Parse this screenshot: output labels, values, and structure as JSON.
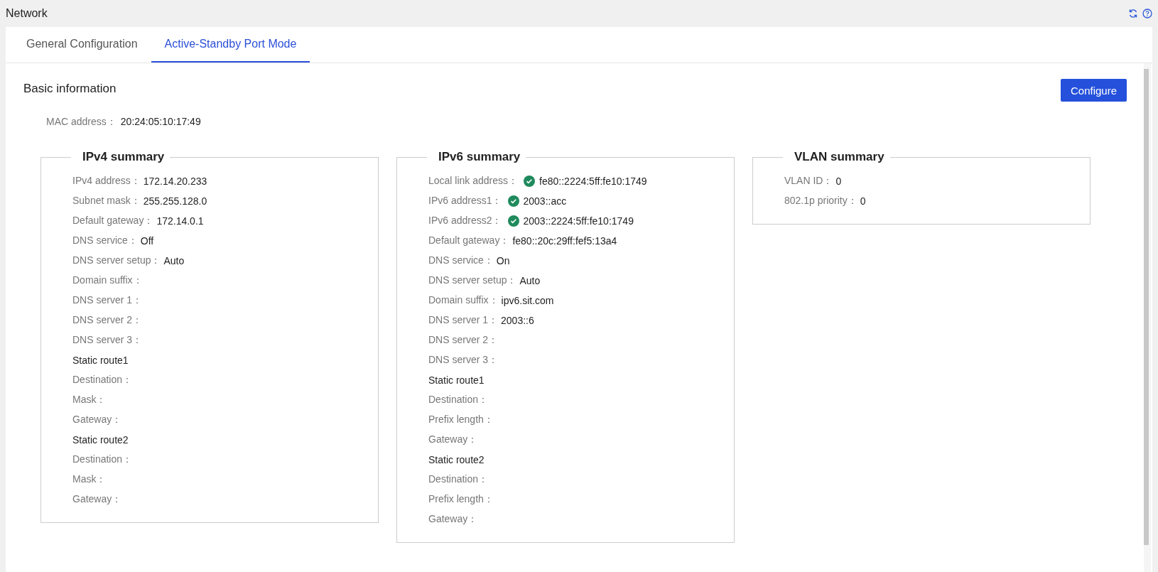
{
  "page": {
    "title": "Network"
  },
  "tabs": [
    {
      "label": "General Configuration",
      "selected": false
    },
    {
      "label": "Active-Standby Port Mode",
      "selected": true
    }
  ],
  "section": {
    "title": "Basic information",
    "button": "Configure",
    "mac_label": "MAC address：",
    "mac_value": "20:24:05:10:17:49"
  },
  "panels": [
    {
      "title": "IPv4 summary",
      "rows": [
        {
          "kind": "field",
          "label": "IPv4 address：",
          "value": "172.14.20.233"
        },
        {
          "kind": "field",
          "label": "Subnet mask：",
          "value": "255.255.128.0"
        },
        {
          "kind": "field",
          "label": "Default gateway：",
          "value": "172.14.0.1"
        },
        {
          "kind": "field",
          "label": "DNS service：",
          "value": "Off"
        },
        {
          "kind": "field",
          "label": "DNS server setup：",
          "value": "Auto"
        },
        {
          "kind": "field",
          "label": "Domain suffix："
        },
        {
          "kind": "field",
          "label": "DNS server 1："
        },
        {
          "kind": "field",
          "label": "DNS server 2："
        },
        {
          "kind": "field",
          "label": "DNS server 3："
        },
        {
          "kind": "heading",
          "label": "Static route1"
        },
        {
          "kind": "field",
          "label": "Destination："
        },
        {
          "kind": "field",
          "label": "Mask："
        },
        {
          "kind": "field",
          "label": "Gateway："
        },
        {
          "kind": "heading",
          "label": "Static route2"
        },
        {
          "kind": "field",
          "label": "Destination："
        },
        {
          "kind": "field",
          "label": "Mask："
        },
        {
          "kind": "field",
          "label": "Gateway："
        }
      ]
    },
    {
      "title": "IPv6 summary",
      "rows": [
        {
          "kind": "field",
          "label": "Local link address：",
          "value": "fe80::2224:5ff:fe10:1749",
          "verified": true
        },
        {
          "kind": "field",
          "label": "IPv6 address1：",
          "value": "2003::acc",
          "verified": true
        },
        {
          "kind": "field",
          "label": "IPv6 address2：",
          "value": "2003::2224:5ff:fe10:1749",
          "verified": true
        },
        {
          "kind": "field",
          "label": "Default gateway：",
          "value": "fe80::20c:29ff:fef5:13a4",
          "verified": false
        },
        {
          "kind": "field",
          "label": "DNS service：",
          "value": "On",
          "verified": false
        },
        {
          "kind": "field",
          "label": "DNS server setup：",
          "value": "Auto",
          "verified": false
        },
        {
          "kind": "field",
          "label": "Domain suffix：",
          "value": "ipv6.sit.com",
          "verified": false
        },
        {
          "kind": "field",
          "label": "DNS server 1：",
          "value": "2003::6",
          "verified": false
        },
        {
          "kind": "field",
          "label": "DNS server 2：",
          "verified": false
        },
        {
          "kind": "field",
          "label": "DNS server 3：",
          "verified": false
        },
        {
          "kind": "heading",
          "label": "Static route1"
        },
        {
          "kind": "field",
          "label": "Destination：",
          "verified": false
        },
        {
          "kind": "field",
          "label": "Prefix length：",
          "verified": false
        },
        {
          "kind": "field",
          "label": "Gateway：",
          "verified": false
        },
        {
          "kind": "heading",
          "label": "Static route2"
        },
        {
          "kind": "field",
          "label": "Destination：",
          "verified": false
        },
        {
          "kind": "field",
          "label": "Prefix length：",
          "verified": false
        },
        {
          "kind": "field",
          "label": "Gateway：",
          "verified": false
        }
      ]
    },
    {
      "title": "VLAN summary",
      "rows": [
        {
          "kind": "field",
          "label": "VLAN ID：",
          "value": "0"
        },
        {
          "kind": "field",
          "label": "802.1p priority：",
          "value": "0"
        }
      ]
    }
  ]
}
